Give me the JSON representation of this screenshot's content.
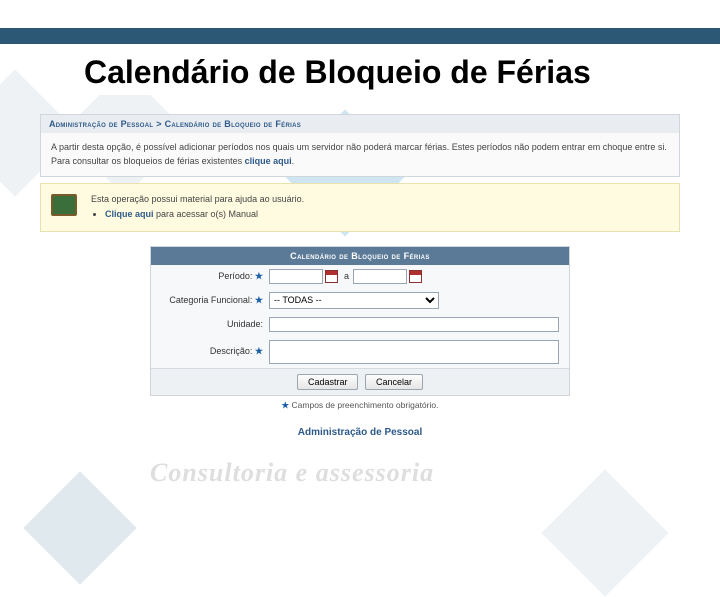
{
  "page": {
    "title": "Calendário de Bloqueio de Férias",
    "watermark": "Consultoria e assessoria"
  },
  "breadcrumb": {
    "root": "Administração de Pessoal",
    "sep": ">",
    "current": "Calendário de Bloqueio de Férias"
  },
  "intro": {
    "text_before": "A partir desta opção, é possível adicionar períodos nos quais um servidor não poderá marcar férias. Estes períodos não podem entrar em choque entre si. Para consultar os bloqueios de férias existentes ",
    "link": "clique aqui",
    "text_after": "."
  },
  "help": {
    "line1": "Esta operação possui material para ajuda ao usuário.",
    "link_prefix": "Clique aqui",
    "link_suffix": " para acessar o(s) Manual"
  },
  "form": {
    "header": "Calendário de Bloqueio de Férias",
    "labels": {
      "periodo": "Período:",
      "a": "a",
      "categoria": "Categoria Funcional:",
      "unidade": "Unidade:",
      "descricao": "Descrição:"
    },
    "values": {
      "data_inicio": "",
      "data_fim": "",
      "categoria_sel": "-- TODAS --",
      "unidade": "",
      "descricao": ""
    },
    "buttons": {
      "cadastrar": "Cadastrar",
      "cancelar": "Cancelar"
    },
    "required_note": "Campos de preenchimento obrigatório."
  },
  "footer": {
    "link": "Administração de Pessoal"
  }
}
